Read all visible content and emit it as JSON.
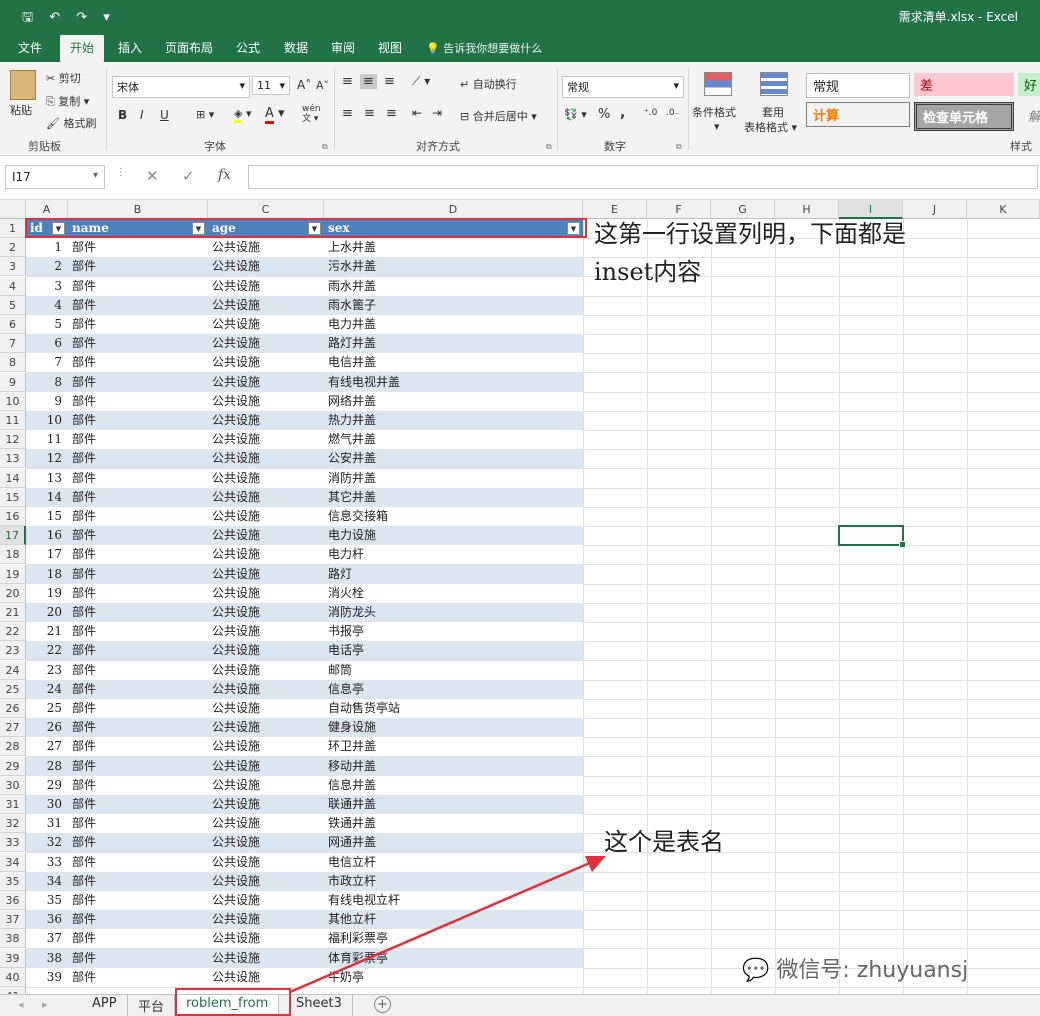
{
  "window": {
    "title": "需求清单.xlsx - Excel",
    "qat": [
      "save",
      "undo",
      "redo",
      "customize"
    ]
  },
  "ribbon": {
    "tabs": [
      "文件",
      "开始",
      "插入",
      "页面布局",
      "公式",
      "数据",
      "审阅",
      "视图"
    ],
    "active_tab": "开始",
    "tell_me": "告诉我你想要做什么",
    "clipboard": {
      "paste": "粘贴",
      "cut": "剪切",
      "copy": "复制",
      "format_painter": "格式刷",
      "label": "剪贴板"
    },
    "font": {
      "name": "宋体",
      "size": "11",
      "grow": "A",
      "shrink": "A",
      "bold": "B",
      "italic": "I",
      "underline": "U",
      "wen": "wén",
      "wen2": "文",
      "label": "字体"
    },
    "alignment": {
      "wrap": "自动换行",
      "merge": "合并后居中",
      "label": "对齐方式"
    },
    "number": {
      "format": "常规",
      "percent": "%",
      "comma": ",",
      "label": "数字"
    },
    "styles": {
      "conditional": "条件格式",
      "table_format_1": "套用",
      "table_format_2": "表格格式",
      "normal": "常规",
      "bad": "差",
      "good": "好",
      "calc": "计算",
      "check": "检查单元格",
      "explain": "解",
      "label": "样式"
    }
  },
  "formula_bar": {
    "name_box": "I17",
    "fx": "fx",
    "value": ""
  },
  "sheet": {
    "columns": [
      "A",
      "B",
      "C",
      "D",
      "E",
      "F",
      "G",
      "H",
      "I",
      "J",
      "K"
    ],
    "selected_column": "I",
    "selected_row": "17",
    "header": [
      "id",
      "name",
      "age",
      "sex"
    ],
    "rows": [
      [
        "1",
        "部件",
        "公共设施",
        "上水井盖"
      ],
      [
        "2",
        "部件",
        "公共设施",
        "污水井盖"
      ],
      [
        "3",
        "部件",
        "公共设施",
        "雨水井盖"
      ],
      [
        "4",
        "部件",
        "公共设施",
        "雨水篦子"
      ],
      [
        "5",
        "部件",
        "公共设施",
        "电力井盖"
      ],
      [
        "6",
        "部件",
        "公共设施",
        "路灯井盖"
      ],
      [
        "7",
        "部件",
        "公共设施",
        "电信井盖"
      ],
      [
        "8",
        "部件",
        "公共设施",
        "有线电视井盖"
      ],
      [
        "9",
        "部件",
        "公共设施",
        "网络井盖"
      ],
      [
        "10",
        "部件",
        "公共设施",
        "热力井盖"
      ],
      [
        "11",
        "部件",
        "公共设施",
        "燃气井盖"
      ],
      [
        "12",
        "部件",
        "公共设施",
        "公安井盖"
      ],
      [
        "13",
        "部件",
        "公共设施",
        "消防井盖"
      ],
      [
        "14",
        "部件",
        "公共设施",
        "其它井盖"
      ],
      [
        "15",
        "部件",
        "公共设施",
        "信息交接箱"
      ],
      [
        "16",
        "部件",
        "公共设施",
        "电力设施"
      ],
      [
        "17",
        "部件",
        "公共设施",
        "电力杆"
      ],
      [
        "18",
        "部件",
        "公共设施",
        "路灯"
      ],
      [
        "19",
        "部件",
        "公共设施",
        "消火栓"
      ],
      [
        "20",
        "部件",
        "公共设施",
        "消防龙头"
      ],
      [
        "21",
        "部件",
        "公共设施",
        "书报亭"
      ],
      [
        "22",
        "部件",
        "公共设施",
        "电话亭"
      ],
      [
        "23",
        "部件",
        "公共设施",
        "邮筒"
      ],
      [
        "24",
        "部件",
        "公共设施",
        "信息亭"
      ],
      [
        "25",
        "部件",
        "公共设施",
        "自动售货亭站"
      ],
      [
        "26",
        "部件",
        "公共设施",
        "健身设施"
      ],
      [
        "27",
        "部件",
        "公共设施",
        "环卫井盖"
      ],
      [
        "28",
        "部件",
        "公共设施",
        "移动井盖"
      ],
      [
        "29",
        "部件",
        "公共设施",
        "信息井盖"
      ],
      [
        "30",
        "部件",
        "公共设施",
        "联通井盖"
      ],
      [
        "31",
        "部件",
        "公共设施",
        "铁通井盖"
      ],
      [
        "32",
        "部件",
        "公共设施",
        "网通井盖"
      ],
      [
        "33",
        "部件",
        "公共设施",
        "电信立杆"
      ],
      [
        "34",
        "部件",
        "公共设施",
        "市政立杆"
      ],
      [
        "35",
        "部件",
        "公共设施",
        "有线电视立杆"
      ],
      [
        "36",
        "部件",
        "公共设施",
        "其他立杆"
      ],
      [
        "37",
        "部件",
        "公共设施",
        "福利彩票亭"
      ],
      [
        "38",
        "部件",
        "公共设施",
        "体育彩票亭"
      ],
      [
        "39",
        "部件",
        "公共设施",
        "牛奶亭"
      ]
    ]
  },
  "annotations": {
    "header_note_1": "这第一行设置列明，下面都是",
    "header_note_2": "inset内容",
    "sheet_note": "这个是表名"
  },
  "sheet_tabs": [
    "APP",
    "平台",
    "roblem_from",
    "Sheet3"
  ],
  "active_sheet": "roblem_from",
  "watermark": "微信号: zhuyuansj",
  "colors": {
    "excel_green": "#217346",
    "table_header": "#4f81bd",
    "table_band": "#dce6f1",
    "annotation_red": "#e0323a"
  }
}
